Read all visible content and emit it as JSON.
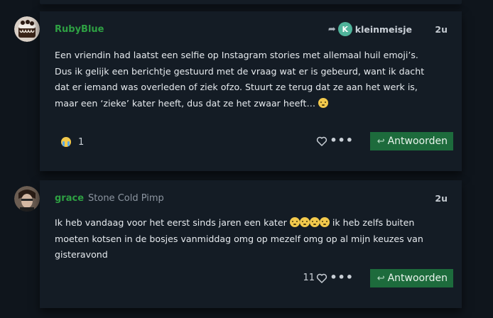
{
  "posts": [
    {
      "username": "RubyBlue",
      "user_title": "",
      "reply_to": {
        "initial": "K",
        "name": "kleinmeisje"
      },
      "time": "2u",
      "paragraph": "Een vriendin had laatst een selfie op Instagram stories met allemaal huil emoji’s. Dus ik gelijk een berichtje gestuurd met de vraag wat er is gebeurd, want ik dacht dat er iemand was overleden of ziek ofzo. Stuurt ze terug dat ze aan het werk is, maar een ‘zieke’ kater heeft, dus dat ze het zwaar heeft…",
      "reaction_count": "1",
      "like_count": "",
      "reply_label": "Antwoorden"
    },
    {
      "username": "grace",
      "user_title": "Stone Cold Pimp",
      "time": "2u",
      "paragraph_part1": "Ik heb vandaag voor het eerst sinds jaren een kater",
      "paragraph_part2": "ik heb zelfs buiten moeten kotsen in de bosjes vanmiddag omg op mezelf omg op al mijn keuzes van gisteravond",
      "like_count": "11",
      "reply_label": "Antwoorden"
    }
  ],
  "colors": {
    "accent": "#2ea043",
    "button": "#1d6b3c",
    "background": "#0f151c",
    "card": "#141c25"
  },
  "icons": [
    "share-arrow-icon",
    "heart-icon",
    "more-dots-icon",
    "reply-icon",
    "emoji-icon",
    "avatar"
  ]
}
